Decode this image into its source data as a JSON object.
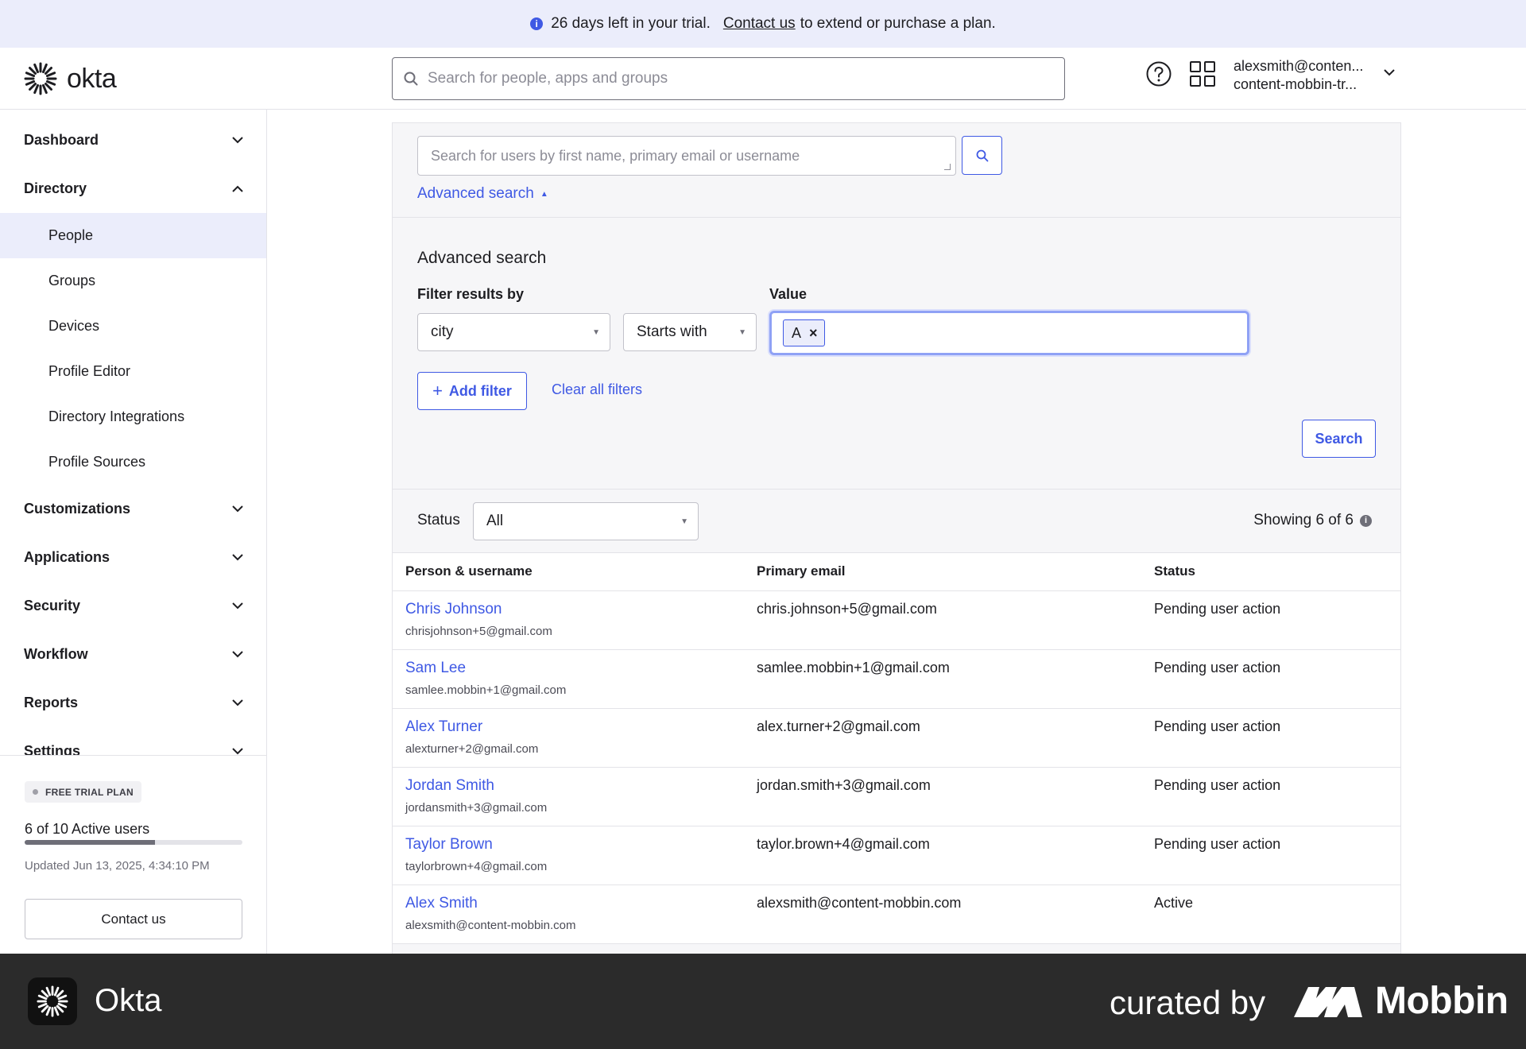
{
  "banner": {
    "text": "26 days left in your trial.",
    "link": "Contact us",
    "suffix": "to extend or purchase a plan."
  },
  "header": {
    "logo": "okta",
    "search_placeholder": "Search for people, apps and groups",
    "user_email": "alexsmith@conten...",
    "user_org": "content-mobbin-tr..."
  },
  "sidebar": {
    "sections": [
      {
        "label": "Dashboard",
        "expanded": false
      },
      {
        "label": "Directory",
        "expanded": true
      },
      {
        "label": "Customizations",
        "expanded": false
      },
      {
        "label": "Applications",
        "expanded": false
      },
      {
        "label": "Security",
        "expanded": false
      },
      {
        "label": "Workflow",
        "expanded": false
      },
      {
        "label": "Reports",
        "expanded": false
      },
      {
        "label": "Settings",
        "expanded": false
      }
    ],
    "directory_items": [
      "People",
      "Groups",
      "Devices",
      "Profile Editor",
      "Directory Integrations",
      "Profile Sources"
    ],
    "active_item": "People"
  },
  "trial_card": {
    "badge": "FREE TRIAL PLAN",
    "users": "6 of 10 Active users",
    "progress_fraction": 0.6,
    "updated": "Updated Jun 13, 2025, 4:34:10 PM",
    "contact": "Contact us"
  },
  "search": {
    "placeholder": "Search for users by first name, primary email or username",
    "advanced_toggle": "Advanced search"
  },
  "advanced": {
    "title": "Advanced search",
    "filter_label": "Filter results by",
    "value_label": "Value",
    "filter_attribute": "city",
    "operator": "Starts with",
    "value_chip": "A",
    "add_filter": "Add filter",
    "clear_filters": "Clear all filters",
    "search_button": "Search"
  },
  "results": {
    "status_label": "Status",
    "status_value": "All",
    "showing": "Showing 6 of 6",
    "columns": [
      "Person & username",
      "Primary email",
      "Status"
    ],
    "rows": [
      {
        "name": "Chris Johnson",
        "username": "chrisjohnson+5@gmail.com",
        "email": "chris.johnson+5@gmail.com",
        "status": "Pending user action"
      },
      {
        "name": "Sam Lee",
        "username": "samlee.mobbin+1@gmail.com",
        "email": "samlee.mobbin+1@gmail.com",
        "status": "Pending user action"
      },
      {
        "name": "Alex Turner",
        "username": "alexturner+2@gmail.com",
        "email": "alex.turner+2@gmail.com",
        "status": "Pending user action"
      },
      {
        "name": "Jordan Smith",
        "username": "jordansmith+3@gmail.com",
        "email": "jordan.smith+3@gmail.com",
        "status": "Pending user action"
      },
      {
        "name": "Taylor Brown",
        "username": "taylorbrown+4@gmail.com",
        "email": "taylor.brown+4@gmail.com",
        "status": "Pending user action"
      },
      {
        "name": "Alex Smith",
        "username": "alexsmith@content-mobbin.com",
        "email": "alexsmith@content-mobbin.com",
        "status": "Active"
      }
    ]
  },
  "footer": {
    "app_name": "Okta",
    "curated": "curated by",
    "brand": "Mobbin"
  },
  "colors": {
    "accent": "#3f59e4",
    "banner_bg": "#ebedfb",
    "footer_bg": "#2b2b2b"
  }
}
